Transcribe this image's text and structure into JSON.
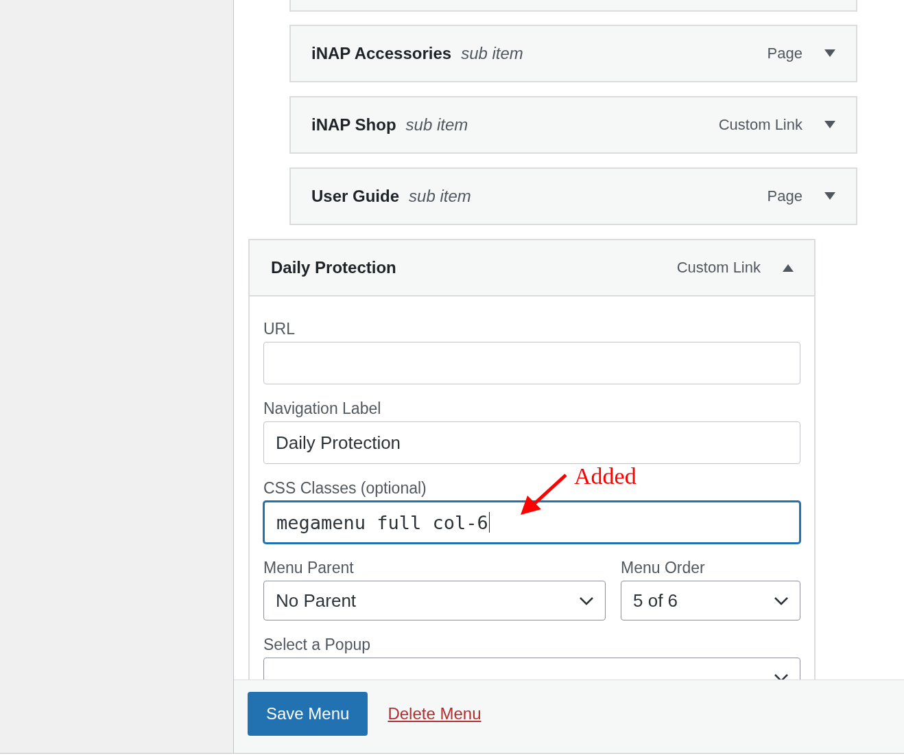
{
  "menu_items": [
    {
      "title": "iNAP Accessories",
      "sub_label": "sub item",
      "type": "Page",
      "expanded": false
    },
    {
      "title": "iNAP Shop",
      "sub_label": "sub item",
      "type": "Custom Link",
      "expanded": false
    },
    {
      "title": "User Guide",
      "sub_label": "sub item",
      "type": "Page",
      "expanded": false
    },
    {
      "title": "Daily Protection",
      "type": "Custom Link",
      "expanded": true
    }
  ],
  "item_settings": {
    "url": {
      "label": "URL"
    },
    "navigation_label": {
      "label": "Navigation Label",
      "value": "Daily Protection"
    },
    "css_classes": {
      "label": "CSS Classes (optional)",
      "value": "megamenu full col-6",
      "focused": true
    },
    "menu_parent": {
      "label": "Menu Parent",
      "value": "No Parent"
    },
    "menu_order": {
      "label": "Menu Order",
      "value": "5 of 6"
    },
    "popup": {
      "label": "Select a Popup"
    }
  },
  "annotation": {
    "text": "Added"
  },
  "footer": {
    "save_button": "Save Menu",
    "delete_link": "Delete Menu"
  }
}
